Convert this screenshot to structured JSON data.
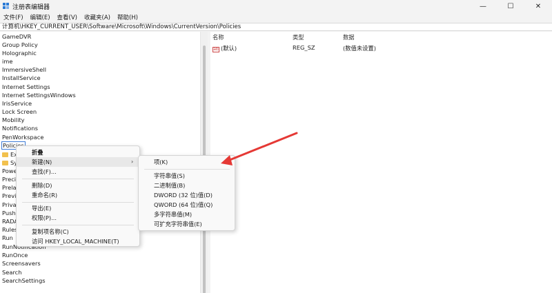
{
  "window": {
    "title": "注册表编辑器",
    "controls": {
      "minimize": "—",
      "maximize": "☐",
      "close": "✕"
    }
  },
  "menubar": [
    "文件(F)",
    "编辑(E)",
    "查看(V)",
    "收藏夹(A)",
    "帮助(H)"
  ],
  "address": "计算机\\HKEY_CURRENT_USER\\Software\\Microsoft\\Windows\\CurrentVersion\\Policies",
  "tree": {
    "items": [
      "GameDVR",
      "Group Policy",
      "Holographic",
      "ime",
      "ImmersiveShell",
      "InstallService",
      "Internet Settings",
      "Internet SettingsWindows",
      "IrisService",
      "Lock Screen",
      "Mobility",
      "Notifications",
      "PenWorkspace",
      "Policies",
      "Exp",
      "Sys",
      "Powe",
      "Precis",
      "Prelau",
      "Previe",
      "Privac",
      "PushN",
      "RADA",
      "Rules",
      "Run",
      "RunNotification",
      "RunOnce",
      "Screensavers",
      "Search",
      "SearchSettings"
    ],
    "selected": "Policies"
  },
  "list": {
    "headers": {
      "name": "名称",
      "type": "类型",
      "data": "数据"
    },
    "rows": [
      {
        "name": "(默认)",
        "type": "REG_SZ",
        "data": "(数值未设置)"
      }
    ]
  },
  "context_menu": {
    "collapse": "折叠",
    "new": "新建(N)",
    "find": "查找(F)...",
    "delete": "删除(D)",
    "rename": "重命名(R)",
    "export": "导出(E)",
    "permissions": "权限(P)...",
    "copy_key_name": "复制项名称(C)",
    "visit": "访问 HKEY_LOCAL_MACHINE(T)"
  },
  "submenu": {
    "key": "项(K)",
    "string": "字符串值(S)",
    "binary": "二进制值(B)",
    "dword": "DWORD (32 位)值(D)",
    "qword": "QWORD (64 位)值(Q)",
    "multi_string": "多字符串值(M)",
    "expandable_string": "可扩充字符串值(E)"
  },
  "colors": {
    "annotation_arrow": "#e53935",
    "selection_border": "#3c7ad6",
    "folder": "#f2c14e"
  }
}
